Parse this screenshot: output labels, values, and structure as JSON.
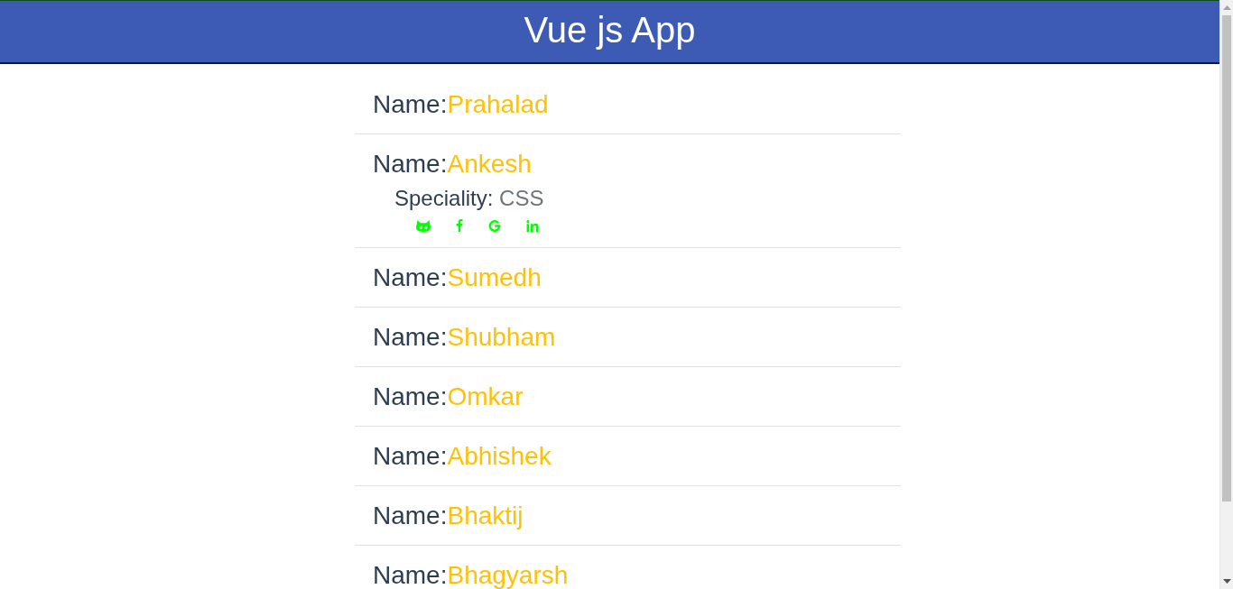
{
  "header": {
    "title": "Vue js App"
  },
  "people": [
    {
      "label": "Name:",
      "name": "Prahalad"
    },
    {
      "label": "Name:",
      "name": "Ankesh",
      "details": {
        "label": "Speciality:",
        "value": "CSS",
        "links": [
          {
            "kind": "github"
          },
          {
            "kind": "facebook"
          },
          {
            "kind": "google"
          },
          {
            "kind": "linkedin"
          }
        ]
      }
    },
    {
      "label": "Name:",
      "name": "Sumedh"
    },
    {
      "label": "Name:",
      "name": "Shubham"
    },
    {
      "label": "Name:",
      "name": "Omkar"
    },
    {
      "label": "Name:",
      "name": "Abhishek"
    },
    {
      "label": "Name:",
      "name": "Bhaktij"
    },
    {
      "label": "Name:",
      "name": "Bhagyarsh"
    }
  ]
}
